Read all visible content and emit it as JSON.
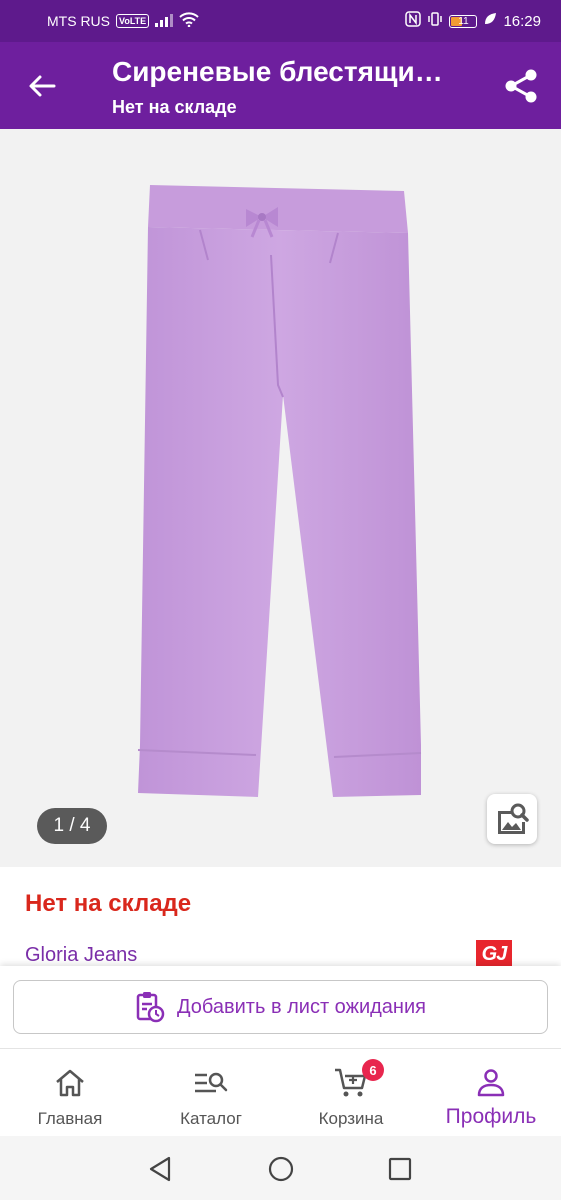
{
  "status_bar": {
    "carrier": "MTS RUS",
    "volte": "VoLTE",
    "battery": "11",
    "time": "16:29"
  },
  "toolbar": {
    "title": "Сиреневые блестящи…",
    "subtitle": "Нет на складе"
  },
  "gallery": {
    "counter": "1 / 4",
    "product_color": "#c9a0dc"
  },
  "product": {
    "stock_status": "Нет на складе",
    "brand": "Gloria Jeans",
    "brand_logo": "GJ"
  },
  "wishlist": {
    "button_label": "Добавить в лист ожидания"
  },
  "bottom_nav": {
    "items": [
      {
        "label": "Главная",
        "icon": "home-icon"
      },
      {
        "label": "Каталог",
        "icon": "catalog-search-icon"
      },
      {
        "label": "Корзина",
        "icon": "cart-icon",
        "badge": "6"
      },
      {
        "label": "Профиль",
        "icon": "profile-icon"
      }
    ],
    "active": "Профиль"
  },
  "colors": {
    "primary": "#6e1f9e",
    "status_bar": "#5e1a8c",
    "accent": "#8a2fb6",
    "out_of_stock": "#d9271c",
    "badge": "#e8264e"
  }
}
